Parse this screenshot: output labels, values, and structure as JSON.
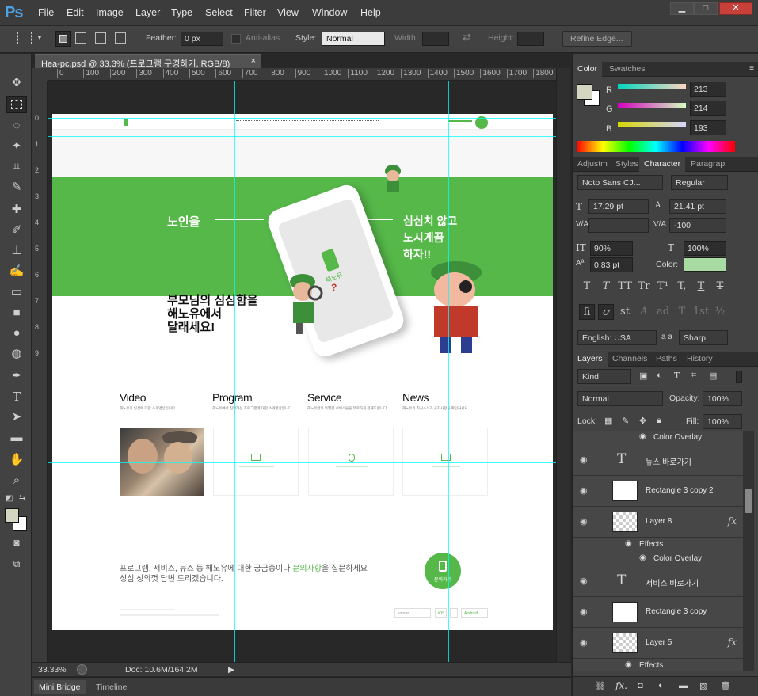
{
  "app": {
    "logo": "Ps"
  },
  "menu": [
    "File",
    "Edit",
    "Image",
    "Layer",
    "Type",
    "Select",
    "Filter",
    "View",
    "Window",
    "Help"
  ],
  "window_controls": [
    "▁",
    "□",
    "✕"
  ],
  "options": {
    "feather_label": "Feather:",
    "feather_value": "0 px",
    "antialias_label": "Anti-alias",
    "style_label": "Style:",
    "style_value": "Normal",
    "width_label": "Width:",
    "height_label": "Height:",
    "refine_edge": "Refine Edge..."
  },
  "document": {
    "tab_title": "Hea-pc.psd @ 33.3% (프로그램 구경하기, RGB/8)",
    "close": "×",
    "ruler_ticks": [
      "0",
      "100",
      "200",
      "300",
      "400",
      "500",
      "600",
      "700",
      "800",
      "900",
      "1000",
      "1100",
      "1200",
      "1300",
      "1400",
      "1500",
      "1600",
      "1700",
      "1800"
    ],
    "ruler_v_ticks": [
      "0",
      "1",
      "2",
      "3",
      "4",
      "5",
      "6",
      "7",
      "8",
      "9"
    ]
  },
  "design": {
    "left_text": "노인을",
    "right_text_line1": "심심치 않고",
    "right_text_line2": "노시게끔",
    "right_text_line3": "하자!!",
    "headline_line1": "부모님의 심심함을",
    "headline_line2": "해노유에서",
    "headline_line3": "달래세요!",
    "phone_brand": "해노유",
    "sections": [
      {
        "title": "Video",
        "desc": "해노유의 일상에 대한 소개영상입니다."
      },
      {
        "title": "Program",
        "desc": "해노유에서 진행하는 프로그램에 대한 소개영상입니다."
      },
      {
        "title": "Service",
        "desc": "해노유만의 특별한 서비스들을 무료하게 전해드립니다."
      },
      {
        "title": "News",
        "desc": "해노유의 최신소식과 공지사항을 확인하세요."
      }
    ],
    "bottom_text_line1_pre": "프로그램, 서비스, 뉴스 등 해노유에 대한 궁금증이나 ",
    "bottom_text_highlight": "문의사항",
    "bottom_text_line1_post": "을 질문하세요",
    "bottom_text_line2": "성심 성의껏 답변 드리겠습니다.",
    "contact_label": "문의하기",
    "footer_select": "korean",
    "footer_ios": "iOS",
    "footer_android": "Android",
    "accent_color": "#56b849"
  },
  "status": {
    "zoom": "33.33%",
    "doc": "Doc: 10.6M/164.2M",
    "arrow": "▶"
  },
  "bottom_tabs": [
    "Mini Bridge",
    "Timeline"
  ],
  "color_panel": {
    "tabs": [
      "Color",
      "Swatches"
    ],
    "r_label": "R",
    "r_value": "213",
    "g_label": "G",
    "g_value": "214",
    "b_label": "B",
    "b_value": "193"
  },
  "char_panel": {
    "tabs": [
      "Adjustm",
      "Styles",
      "Character",
      "Paragrap"
    ],
    "font": "Noto Sans CJ...",
    "style": "Regular",
    "size": "17.29 pt",
    "leading": "21.41 pt",
    "tracking": "-100",
    "vscale": "90%",
    "hscale": "100%",
    "baseline": "0.83 pt",
    "color_label": "Color:",
    "language": "English: USA",
    "aa_label": "a a",
    "aa_value": "Sharp",
    "style_glyphs": [
      "T",
      "T",
      "TT",
      "Tr",
      "T¹",
      "T,",
      "T",
      "T"
    ],
    "ot_glyphs": [
      "fi",
      "ơ",
      "st",
      "A",
      "ad",
      "T",
      "1st",
      "½"
    ]
  },
  "layers_panel": {
    "tabs": [
      "Layers",
      "Channels",
      "Paths",
      "History"
    ],
    "kind": "Kind",
    "blend": "Normal",
    "opacity_label": "Opacity:",
    "opacity": "100%",
    "lock_label": "Lock:",
    "fill_label": "Fill:",
    "fill": "100%",
    "top_sub": "Color Overlay",
    "rows": [
      {
        "type": "text",
        "name": "뉴스 바로가기"
      },
      {
        "type": "shape",
        "name": "Rectangle 3 copy 2"
      },
      {
        "type": "pixel",
        "name": "Layer 8",
        "fx": "fx"
      },
      {
        "type": "text",
        "name": "서비스 바로가기"
      },
      {
        "type": "shape",
        "name": "Rectangle 3 copy"
      },
      {
        "type": "pixel",
        "name": "Layer 5",
        "fx": "fx"
      }
    ],
    "effects_label": "Effects",
    "overlay_label": "Color Overlay"
  }
}
